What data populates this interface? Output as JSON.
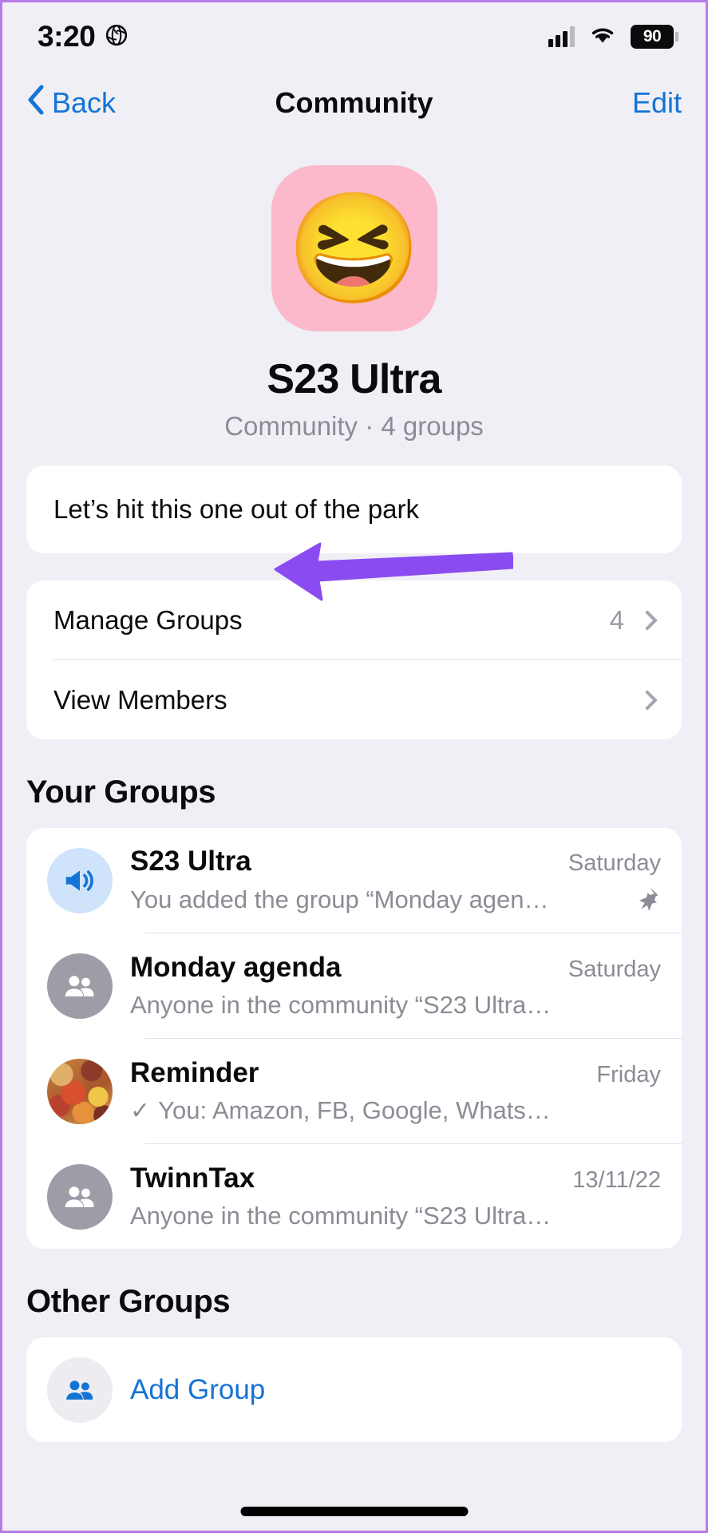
{
  "status_bar": {
    "time": "3:20",
    "location_icon": "location-globe-icon",
    "battery_level": "90"
  },
  "nav": {
    "back_label": "Back",
    "title": "Community",
    "edit_label": "Edit"
  },
  "hero": {
    "avatar_emoji": "😆",
    "avatar_bg": "#fbb9cb",
    "name": "S23 Ultra",
    "subtitle": "Community · 4 groups"
  },
  "description": {
    "text": "Let’s hit this one out of the park"
  },
  "menu": {
    "rows": [
      {
        "label": "Manage Groups",
        "value": "4"
      },
      {
        "label": "View Members",
        "value": ""
      }
    ]
  },
  "your_groups": {
    "heading": "Your Groups",
    "items": [
      {
        "avatar": "announcement-megaphone-icon",
        "title": "S23 Ultra",
        "time": "Saturday",
        "subtitle": "You added the group “Monday agen…",
        "pinned": true,
        "tick": false
      },
      {
        "avatar": "group-people-icon",
        "title": "Monday agenda",
        "time": "Saturday",
        "subtitle": "Anyone in the community “S23 Ultra…",
        "pinned": false,
        "tick": false
      },
      {
        "avatar": "photo-avatar",
        "title": "Reminder",
        "time": "Friday",
        "subtitle": "You: Amazon, FB, Google, Whats…",
        "pinned": false,
        "tick": true
      },
      {
        "avatar": "group-people-icon",
        "title": "TwinnTax",
        "time": "13/11/22",
        "subtitle": "Anyone in the community “S23 Ultra…",
        "pinned": false,
        "tick": false
      }
    ]
  },
  "other_groups": {
    "heading": "Other Groups",
    "add_group_label": "Add Group"
  },
  "annotation": {
    "arrow_color": "#8a4cf0",
    "points_to": "Manage Groups"
  },
  "colors": {
    "accent_blue": "#1474d4",
    "page_bg": "#f0eff5",
    "card_bg": "#ffffff",
    "muted_text": "#8c8c96",
    "frame_border": "#b87ae6"
  }
}
